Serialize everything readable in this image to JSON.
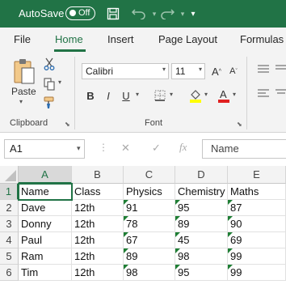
{
  "titlebar": {
    "autosave_label": "AutoSave",
    "autosave_state": "Off"
  },
  "tabs": [
    {
      "label": "File"
    },
    {
      "label": "Home",
      "active": true
    },
    {
      "label": "Insert"
    },
    {
      "label": "Page Layout"
    },
    {
      "label": "Formulas"
    }
  ],
  "ribbon": {
    "clipboard": {
      "paste_label": "Paste",
      "group_label": "Clipboard"
    },
    "font": {
      "font_name": "Calibri",
      "font_size": "11",
      "bold": "B",
      "italic": "I",
      "underline": "U",
      "group_label": "Font",
      "highlight_color": "#ffff00",
      "font_color": "#e02020"
    }
  },
  "formula_bar": {
    "cell_ref": "A1",
    "cancel_symbol": "✕",
    "enter_symbol": "✓",
    "fx_symbol": "fx",
    "content": "Name"
  },
  "sheet": {
    "columns": [
      "A",
      "B",
      "C",
      "D",
      "E"
    ],
    "rows": [
      "1",
      "2",
      "3",
      "4",
      "5",
      "6"
    ],
    "cells": [
      [
        "Name",
        "Class",
        "Physics",
        "Chemistry",
        "Maths"
      ],
      [
        "Dave",
        "12th",
        "91",
        "95",
        "87"
      ],
      [
        "Donny",
        "12th",
        "78",
        "89",
        "90"
      ],
      [
        "Paul",
        "12th",
        "67",
        "45",
        "69"
      ],
      [
        "Ram",
        "12th",
        "89",
        "98",
        "99"
      ],
      [
        "Tim",
        "12th",
        "98",
        "95",
        "99"
      ]
    ]
  },
  "colors": {
    "accent": "#217346",
    "error_flag": "#1e7e34"
  }
}
